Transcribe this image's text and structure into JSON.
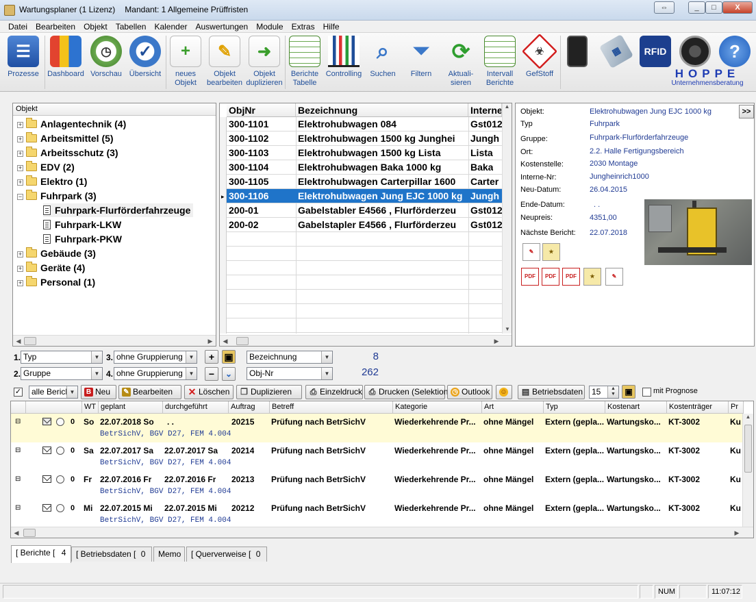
{
  "window": {
    "app_name": "Wartungsplaner",
    "license": "(1 Lizenz)",
    "mandant": "Mandant: 1 Allgemeine Prüffristen",
    "min": "_",
    "max": "□",
    "close": "X",
    "extra": "⇔"
  },
  "menu": [
    "Datei",
    "Bearbeiten",
    "Objekt",
    "Tabellen",
    "Kalender",
    "Auswertungen",
    "Module",
    "Extras",
    "Hilfe"
  ],
  "toolbar": {
    "prozesse": "Prozesse",
    "dashboard": "Dashboard",
    "vorschau": "Vorschau",
    "uebersicht": "Übersicht",
    "neues_objekt": "neues\nObjekt",
    "objekt_bearbeiten": "Objekt\nbearbeiten",
    "objekt_duplizieren": "Objekt\nduplizieren",
    "berichte_tabelle": "Berichte\nTabelle",
    "controlling": "Controlling",
    "suchen": "Suchen",
    "filtern": "Filtern",
    "aktualisieren": "Aktuali-\nsieren",
    "intervall_berichte": "Intervall\nBerichte",
    "gefstoff": "GefStoff",
    "rfid": "RFID",
    "hoppe": "HOPPE",
    "hoppe_sub": "Unternehmensberatung"
  },
  "tree": {
    "header": "Objekt",
    "nodes": [
      {
        "label": "Anlagentechnik",
        "count": "(4)"
      },
      {
        "label": "Arbeitsmittel",
        "count": "(5)"
      },
      {
        "label": "Arbeitsschutz",
        "count": "(3)"
      },
      {
        "label": "EDV",
        "count": "(2)"
      },
      {
        "label": "Elektro",
        "count": "(1)"
      },
      {
        "label": "Fuhrpark",
        "count": "(3)"
      },
      {
        "label": "Fuhrpark-Flurförderfahrzeuge",
        "count": ""
      },
      {
        "label": "Fuhrpark-LKW",
        "count": ""
      },
      {
        "label": "Fuhrpark-PKW",
        "count": ""
      },
      {
        "label": "Gebäude",
        "count": "(3)"
      },
      {
        "label": "Geräte",
        "count": "(4)"
      },
      {
        "label": "Personal",
        "count": "(1)"
      }
    ]
  },
  "objects": {
    "headers": [
      "ObjNr",
      "Bezeichnung",
      "Interne"
    ],
    "rows": [
      [
        "300-1101",
        "Elektrohubwagen 084",
        "Gst012"
      ],
      [
        "300-1102",
        "Elektrohubwagen 1500 kg  Junghei",
        "Jungh"
      ],
      [
        "300-1103",
        "Elektrohubwagen 1500 kg Lista",
        "Lista"
      ],
      [
        "300-1104",
        "Elektrohubwagen Baka 1000 kg",
        "Baka"
      ],
      [
        "300-1105",
        "Elektrohubwagen Carterpillar 1600",
        "Carter"
      ],
      [
        "300-1106",
        "Elektrohubwagen Jung EJC 1000 kg",
        "Jungh"
      ],
      [
        "200-01",
        "Gabelstabler E4566 , Flurförderzeu",
        "Gst012"
      ],
      [
        "200-02",
        "Gabelstapler E4566 , Flurförderzeu",
        "Gst012"
      ]
    ]
  },
  "details": {
    "more": ">>",
    "fields": [
      {
        "label": "Objekt:",
        "value": "Elektrohubwagen Jung EJC 1000 kg"
      },
      {
        "label": "Typ",
        "value": "Fuhrpark"
      },
      {
        "label": "Gruppe:",
        "value": "Fuhrpark-Flurförderfahrzeuge"
      },
      {
        "label": "Ort:",
        "value": "2.2. Halle Fertigungsbereich"
      },
      {
        "label": "Kostenstelle:",
        "value": "2030 Montage"
      },
      {
        "label": "Interne-Nr:",
        "value": "Jungheinrich1000"
      },
      {
        "label": "Neu-Datum:",
        "value": "26.04.2015"
      },
      {
        "label": "Ende-Datum:",
        "value": ". ."
      },
      {
        "label": "Neupreis:",
        "value": "4351,00"
      },
      {
        "label": "Nächste Bericht:",
        "value": "22.07.2018"
      }
    ]
  },
  "grouping": {
    "n1": "1.",
    "n2": "2.",
    "n3": "3.",
    "n4": "4.",
    "g1": "Typ",
    "g2": "Gruppe",
    "g3": "ohne Gruppierung",
    "g4": "ohne Gruppierung",
    "plus": "+",
    "minus": "−",
    "down": "⌄",
    "sort1": "Bezeichnung",
    "sort2": "Obj-Nr",
    "count1": "8",
    "count2": "262"
  },
  "report_toolbar": {
    "filter": "alle Berich",
    "neu": "Neu",
    "bearbeiten": "Bearbeiten",
    "loeschen": "Löschen",
    "duplizieren": "Duplizieren",
    "einzeldruck": "Einzeldruck",
    "drucken": "Drucken (Selektion)",
    "outlook": "Outlook",
    "betriebsdaten": "Betriebsdaten",
    "spin_value": "15",
    "prognose": "mit Prognose"
  },
  "reports": {
    "headers": [
      "WT",
      "geplant",
      "durchgeführt",
      "Auftrag",
      "Betreff",
      "Kategorie",
      "Art",
      "Typ",
      "Kostenart",
      "Kostenträger",
      "Pr"
    ],
    "rows": [
      {
        "wt": "So",
        "geplant": "22.07.2018 So",
        "durch": ". .",
        "auftrag": "20215",
        "betreff": "Prüfung nach BetrSichV",
        "kategorie": "Wiederkehrende Pr...",
        "art": "ohne Mängel",
        "typ": "Extern (gepla...",
        "kostenart": "Wartungsko...",
        "kostentraeger": "KT-3002",
        "pr": "Ku",
        "sub": "BetrSichV, BGV D27, FEM 4.004"
      },
      {
        "wt": "Sa",
        "geplant": "22.07.2017 Sa",
        "durch": "22.07.2017 Sa",
        "auftrag": "20214",
        "betreff": "Prüfung nach BetrSichV",
        "kategorie": "Wiederkehrende Pr...",
        "art": "ohne Mängel",
        "typ": "Extern (gepla...",
        "kostenart": "Wartungsko...",
        "kostentraeger": "KT-3002",
        "pr": "Ku",
        "sub": "BetrSichV, BGV D27, FEM 4.004"
      },
      {
        "wt": "Fr",
        "geplant": "22.07.2016 Fr",
        "durch": "22.07.2016 Fr",
        "auftrag": "20213",
        "betreff": "Prüfung nach BetrSichV",
        "kategorie": "Wiederkehrende Pr...",
        "art": "ohne Mängel",
        "typ": "Extern (gepla...",
        "kostenart": "Wartungsko...",
        "kostentraeger": "KT-3002",
        "pr": "Ku",
        "sub": "BetrSichV, BGV D27, FEM 4.004"
      },
      {
        "wt": "Mi",
        "geplant": "22.07.2015 Mi",
        "durch": "22.07.2015 Mi",
        "auftrag": "20212",
        "betreff": "Prüfung nach BetrSichV",
        "kategorie": "Wiederkehrende Pr...",
        "art": "ohne Mängel",
        "typ": "Extern (gepla...",
        "kostenart": "Wartungsko...",
        "kostentraeger": "KT-3002",
        "pr": "Ku",
        "sub": "BetrSichV, BGV D27, FEM 4.004"
      }
    ]
  },
  "tabs": [
    {
      "label": "[ Berichte [",
      "count": "4"
    },
    {
      "label": "[ Betriebsdaten [",
      "count": "0"
    },
    {
      "label": "Memo",
      "count": ""
    },
    {
      "label": "[ Querverweise [",
      "count": "0"
    }
  ],
  "status": {
    "num": "NUM",
    "time": "11:07:12"
  }
}
